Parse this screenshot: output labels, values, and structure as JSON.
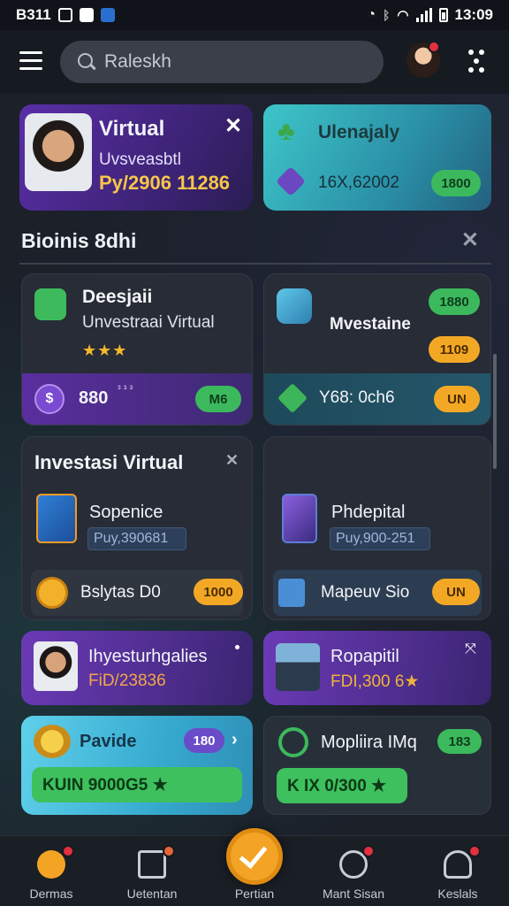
{
  "status_bar": {
    "time_left": "B311",
    "time": "13:09"
  },
  "header": {
    "search_placeholder": "Raleskh"
  },
  "top_cards": {
    "virtual": {
      "title": "Virtual",
      "subtitle": "Uvsveasbtl",
      "amount": "Py/2906 11286"
    },
    "daily": {
      "title": "Ulenajaly",
      "value": "16X,62002",
      "pill": "1800"
    }
  },
  "section": {
    "title": "Bioinis 8dhi"
  },
  "card_a": {
    "title": "Deesjaii",
    "subtitle": "Unvestraai Virtual",
    "stars": "★★★",
    "amount": "880",
    "amount_sup": "³ ³ ³",
    "pill": "M6"
  },
  "card_b": {
    "title": "Mvestaine",
    "pill_green": "1880",
    "pill_orange": "1109",
    "amount": "Y68: 0ch6",
    "pill_bottom": "UN"
  },
  "card_c": {
    "title": "Investasi Virtual",
    "item_name": "Sopenice",
    "item_tag": "Puy,390681",
    "row_label": "Bslytas D0",
    "row_pill": "1000"
  },
  "card_d": {
    "item_name": "Phdepital",
    "item_tag": "Puy,900-251",
    "row_label": "Mapeuv Sio",
    "row_pill": "UN"
  },
  "card_e": {
    "title": "Ihyesturhgalies",
    "amount": "FiD/23836"
  },
  "card_f": {
    "title": "Ropapitil",
    "amount": "FDI,300 6★"
  },
  "card_g": {
    "title": "Pavide",
    "pill": "180",
    "bar": "KUIN 9000G5 ★"
  },
  "card_h": {
    "title": "Mopliira IMq",
    "pill": "183",
    "bar": "K IX 0/300 ★"
  },
  "bottom_nav": {
    "items": [
      {
        "label": "Dermas"
      },
      {
        "label": "Uetentan"
      },
      {
        "label": "Pertian"
      },
      {
        "label": "Mant Sisan"
      },
      {
        "label": "Keslals"
      }
    ]
  },
  "colors": {
    "accent_orange": "#f3a425",
    "accent_green": "#3cb95d",
    "accent_purple": "#6a4cc8"
  }
}
